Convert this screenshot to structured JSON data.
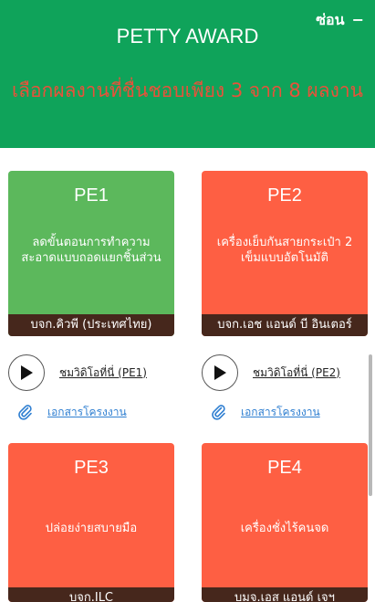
{
  "header": {
    "hide_label": "ซ่อน",
    "hide_icon": "minus-icon",
    "title": "PETTY AWARD",
    "subtitle": "เลือกผลงานที่ชื่นชอบเพียง 3 จาก 8 ผลงาน"
  },
  "colors": {
    "header_bg": "#0fa35a",
    "card_selected": "#5cb85c",
    "card_default": "#fe5f43",
    "company_bar": "#46271c",
    "link_blue": "#2f7fd1"
  },
  "projects": [
    {
      "code": "PE1",
      "description": "ลดขั้นตอนการทำความสะอาดแบบถอดแยกชิ้นส่วน",
      "company": "บจก.คิวพี (ประเทศไทย)",
      "video_label": "ชมวิดิโอที่นี่ (PE1)",
      "doc_label": "เอกสารโครงงาน",
      "selected": true
    },
    {
      "code": "PE2",
      "description": "เครื่องเย็บกันสายกระเป๋า 2 เข็มแบบอัตโนมัติ",
      "company": "บจก.เอช แอนด์ บี อินเตอร์",
      "video_label": "ชมวิดิโอที่นี่ (PE2)",
      "doc_label": "เอกสารโครงงาน",
      "selected": false
    },
    {
      "code": "PE3",
      "description": "ปล่อยง่ายสบายมือ",
      "company": "บจก.ILC",
      "selected": false
    },
    {
      "code": "PE4",
      "description": "เครื่องชั่งไร้คนจด",
      "company": "บมจ.เอส แอนด์ เจฯ",
      "selected": false
    }
  ]
}
